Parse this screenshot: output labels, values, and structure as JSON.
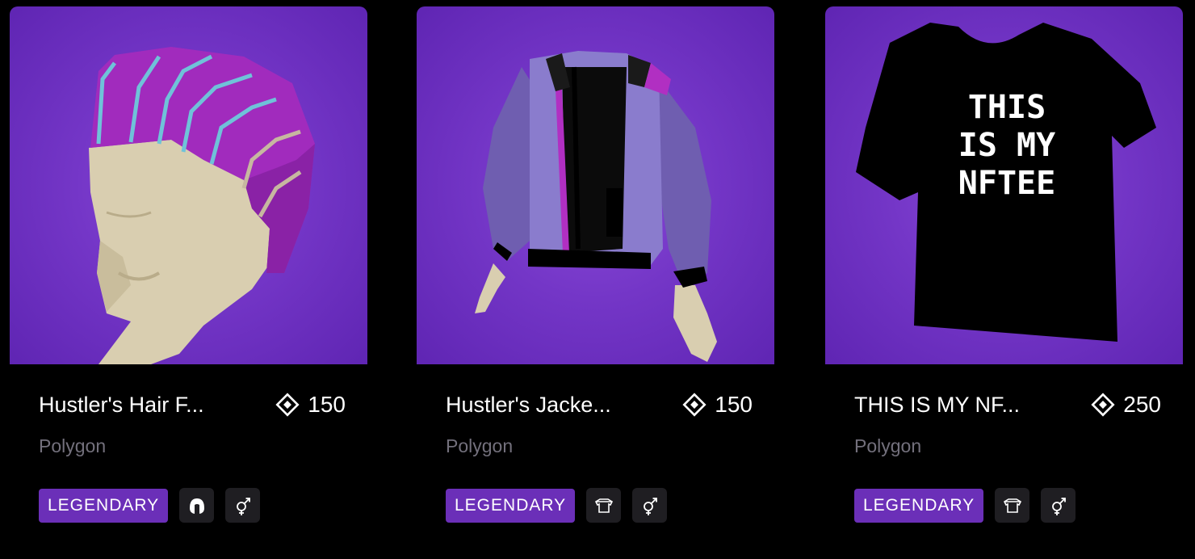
{
  "colors": {
    "background": "#000000",
    "thumbnail_bg": "#7436c7",
    "rarity_legendary": "#6b2fb8",
    "muted_text": "#73707c",
    "tag_bg": "#1f1e22"
  },
  "items": [
    {
      "name": "Hustler's Hair F...",
      "price": "150",
      "price_icon": "mana-diamond-icon",
      "network": "Polygon",
      "rarity": "LEGENDARY",
      "category_icon": "hair-icon",
      "gender_icon": "unisex-icon",
      "thumbnail": "hair-thumbnail"
    },
    {
      "name": "Hustler's Jacke...",
      "price": "150",
      "price_icon": "mana-diamond-icon",
      "network": "Polygon",
      "rarity": "LEGENDARY",
      "category_icon": "upper-body-icon",
      "gender_icon": "unisex-icon",
      "thumbnail": "jacket-thumbnail"
    },
    {
      "name": "THIS IS MY NF...",
      "price": "250",
      "price_icon": "mana-diamond-icon",
      "network": "Polygon",
      "rarity": "LEGENDARY",
      "category_icon": "upper-body-icon",
      "gender_icon": "unisex-icon",
      "thumbnail": "tshirt-thumbnail",
      "shirt_print": [
        "THIS",
        "IS MY",
        "NFTEE"
      ]
    }
  ]
}
